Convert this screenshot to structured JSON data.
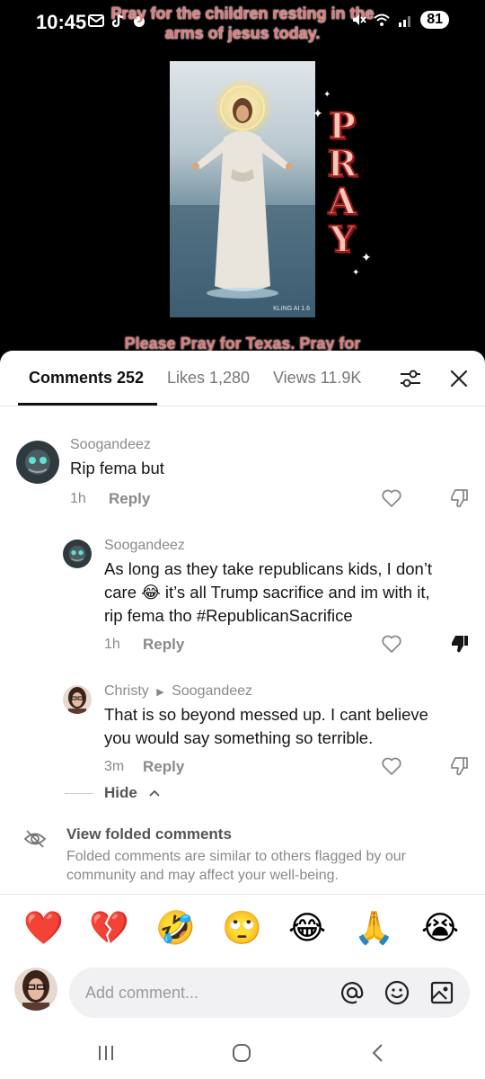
{
  "status_bar": {
    "time": "10:45",
    "battery": "81",
    "left_icons": [
      "mail-icon",
      "tiktok-icon",
      "notification-icon"
    ],
    "right_icons": [
      "mute-icon",
      "wifi-icon",
      "signal-icon"
    ]
  },
  "video": {
    "caption_top": "Pray for the children resting in the arms of jesus today.",
    "caption_bottom": "Please Pray for Texas. Pray for",
    "pray_letters": [
      "P",
      "R",
      "A",
      "Y"
    ],
    "thumb_badge": "KLING AI 1.6"
  },
  "tabs": [
    {
      "label": "Comments 252",
      "active": true
    },
    {
      "label": "Likes 1,280",
      "active": false
    },
    {
      "label": "Views 11.9K",
      "active": false
    }
  ],
  "comments": [
    {
      "username": "Soogandeez",
      "reply_to": "",
      "text": [
        "Rip fema but"
      ],
      "time": "1h",
      "reply_label": "Reply",
      "disliked": false
    },
    {
      "username": "Soogandeez",
      "reply_to": "",
      "text": [
        "As long as they take republicans kids, I don’t",
        "care 😂 it’s all Trump sacrifice and im with it,",
        "rip fema tho #RepublicanSacrifice"
      ],
      "time": "1h",
      "reply_label": "Reply",
      "disliked": true
    },
    {
      "username": "Christy",
      "reply_to": "Soogandeez",
      "text": [
        "That is so beyond messed up. I cant believe",
        "you would say something so terrible."
      ],
      "time": "3m",
      "reply_label": "Reply",
      "disliked": false
    }
  ],
  "hide_label": "Hide",
  "folded": {
    "title": "View folded comments",
    "description": "Folded comments are similar to others flagged by our community and may affect your well-being."
  },
  "emojis": [
    "❤️",
    "💔",
    "🤣",
    "🙄",
    "😂",
    "🙏",
    "😭"
  ],
  "composer": {
    "placeholder": "Add comment..."
  },
  "colors": {
    "caption": "#e07a7a",
    "pray_fill": "#f4c6b7",
    "pray_stroke": "#9b1b1b",
    "text_primary": "#161616",
    "text_secondary": "#8a8a8a"
  }
}
